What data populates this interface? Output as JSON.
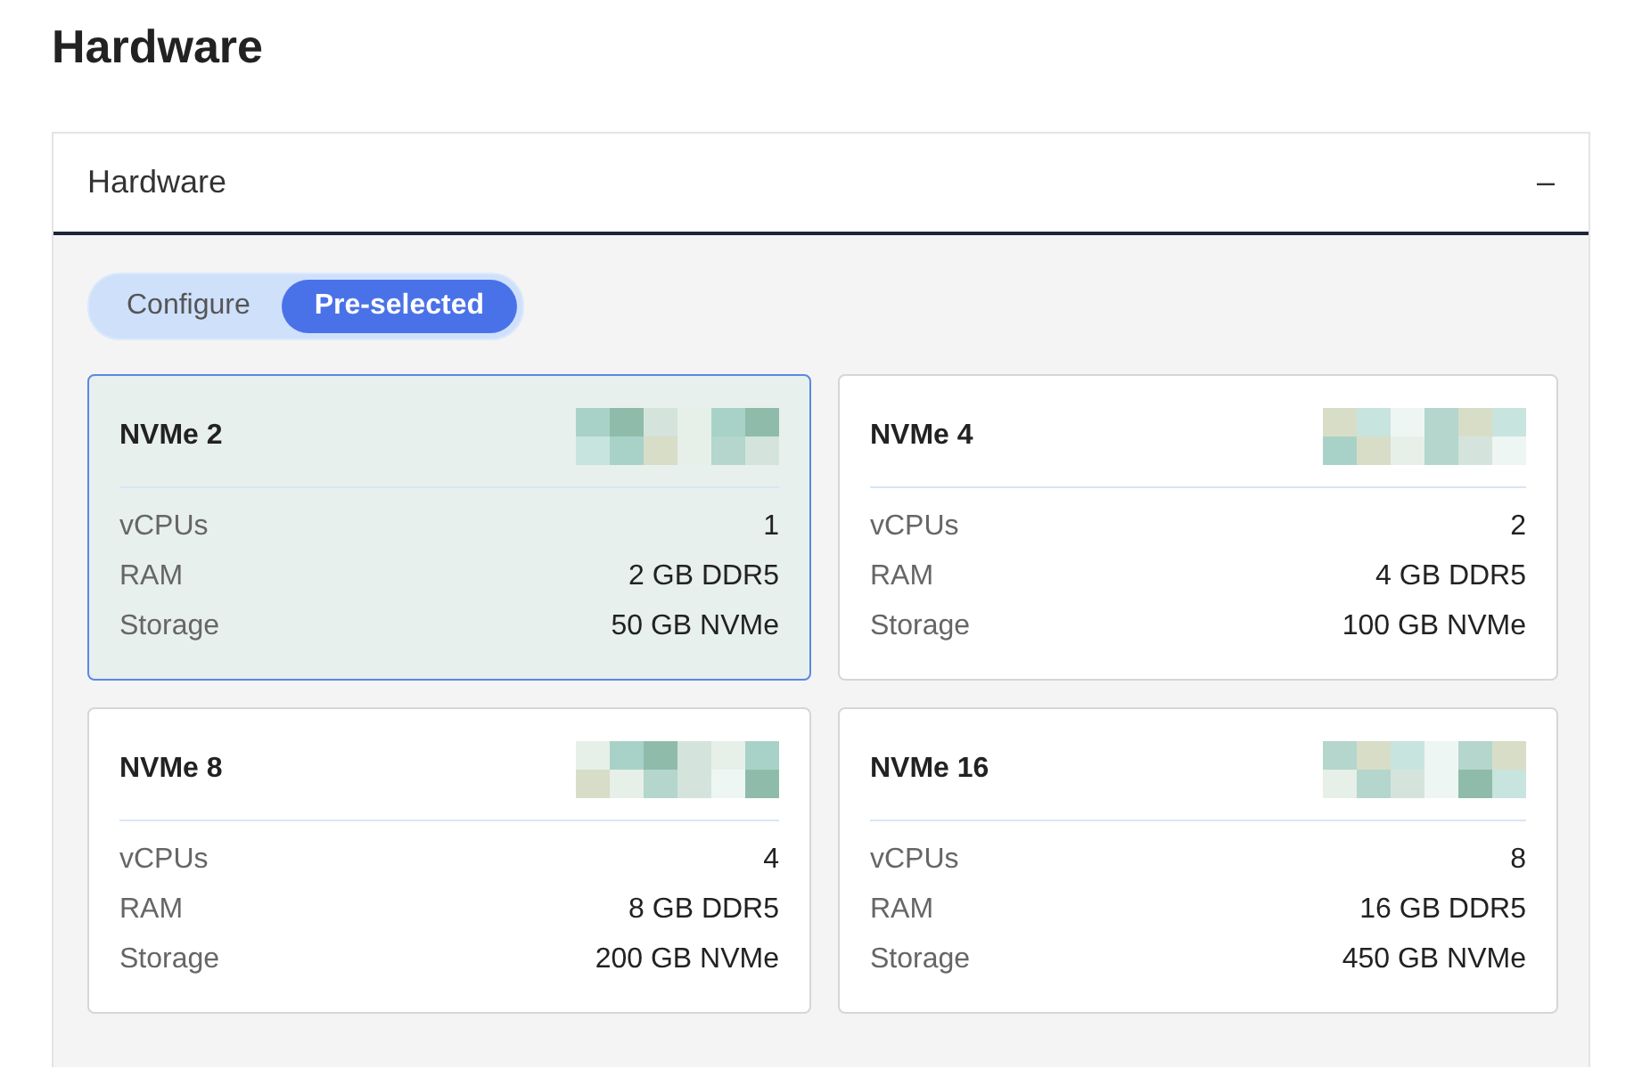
{
  "page_title": "Hardware",
  "panel": {
    "title": "Hardware",
    "collapse_symbol": "–"
  },
  "toggle": [
    {
      "label": "Configure",
      "selected": false
    },
    {
      "label": "Pre-selected",
      "selected": true
    }
  ],
  "plans": [
    {
      "name": "NVMe 2",
      "selected": true,
      "specs": [
        {
          "label": "vCPUs",
          "value": "1"
        },
        {
          "label": "RAM",
          "value": "2 GB DDR5"
        },
        {
          "label": "Storage",
          "value": "50 GB NVMe"
        }
      ]
    },
    {
      "name": "NVMe 4",
      "selected": false,
      "specs": [
        {
          "label": "vCPUs",
          "value": "2"
        },
        {
          "label": "RAM",
          "value": "4 GB DDR5"
        },
        {
          "label": "Storage",
          "value": "100 GB NVMe"
        }
      ]
    },
    {
      "name": "NVMe 8",
      "selected": false,
      "specs": [
        {
          "label": "vCPUs",
          "value": "4"
        },
        {
          "label": "RAM",
          "value": "8 GB DDR5"
        },
        {
          "label": "Storage",
          "value": "200 GB NVMe"
        }
      ]
    },
    {
      "name": "NVMe 16",
      "selected": false,
      "specs": [
        {
          "label": "vCPUs",
          "value": "8"
        },
        {
          "label": "RAM",
          "value": "16 GB DDR5"
        },
        {
          "label": "Storage",
          "value": "450 GB NVMe"
        }
      ]
    }
  ]
}
